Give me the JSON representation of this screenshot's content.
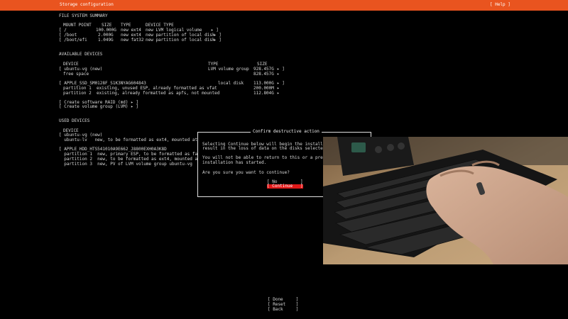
{
  "header": {
    "title": "Storage configuration",
    "help": "[ Help ]"
  },
  "fs_summary": {
    "heading": "FILE SYSTEM SUMMARY",
    "columns": [
      "MOUNT POINT",
      "SIZE",
      "TYPE",
      "DEVICE TYPE"
    ],
    "rows": [
      [
        "[ /",
        "100.000G",
        "new ext4",
        "new LVM logical volume",
        "▸ ]"
      ],
      [
        "[ /boot",
        "2.000G",
        "new ext4",
        "new partition of local disk",
        "▸ ]"
      ],
      [
        "[ /boot/efi",
        "1.049G",
        "new fat32",
        "new partition of local disk",
        "▸ ]"
      ]
    ]
  },
  "available": {
    "heading": "AVAILABLE DEVICES",
    "col_device": "DEVICE",
    "col_type": "TYPE",
    "col_size": "SIZE",
    "vg_name": "[ ubuntu-vg (new)",
    "vg_type": "LVM volume group",
    "vg_size": "928.457G",
    "vg_arrow": "▸ ]",
    "free_label": "free space",
    "free_size": "828.457G",
    "free_arrow": "▸",
    "disk_name": "[ APPLE_SSD_SM0128F_S1K3NYAG604843",
    "disk_type": "local disk",
    "disk_size": "113.000G",
    "disk_arrow": "▸ ]",
    "p1": "partition 1  existing, unused ESP, already formatted as vfat",
    "p1_size": "200.000M",
    "p1_arrow": "▸",
    "p2": "partition 2  existing, already formatted as apfs, not mounted",
    "p2_size": "112.804G",
    "p2_arrow": "▸",
    "raid": "[ Create software RAID (md) ▸ ]",
    "lvm": "[ Create volume group (LVM) ▸ ]"
  },
  "used": {
    "heading": "USED DEVICES",
    "col_device": "DEVICE",
    "vg": "[ ubuntu-vg (new)",
    "lv": "  ubuntu-lv   new, to be formatted as ext4, mounted at",
    "disk": "[ APPLE_HDD_HTS541010A9E662_J8800EXH0A3K8D",
    "p1": "  partition 1  new, primary ESP, to be formatted as fat",
    "p2": "  partition 2  new, to be formatted as ext4, mounted at",
    "p3": "  partition 3  new, PV of LVM volume group ubuntu-vg"
  },
  "dialog": {
    "title": "Confirm destructive action",
    "line1": "Selecting Continue below will begin the installatio",
    "line2": "result in the loss of data on the disks selected to",
    "line3": "You will not be able to return to this or a previou",
    "line4": "installation has started.",
    "line5": "Are you sure you want to continue?",
    "no": "[ No         ]",
    "continue": "[ Continue   ]"
  },
  "footer": {
    "done": "[ Done     ]",
    "reset": "[ Reset    ]",
    "back": "[ Back     ]"
  },
  "colors": {
    "accent": "#e9541f",
    "selected": "#e01818",
    "background": "#000000"
  }
}
